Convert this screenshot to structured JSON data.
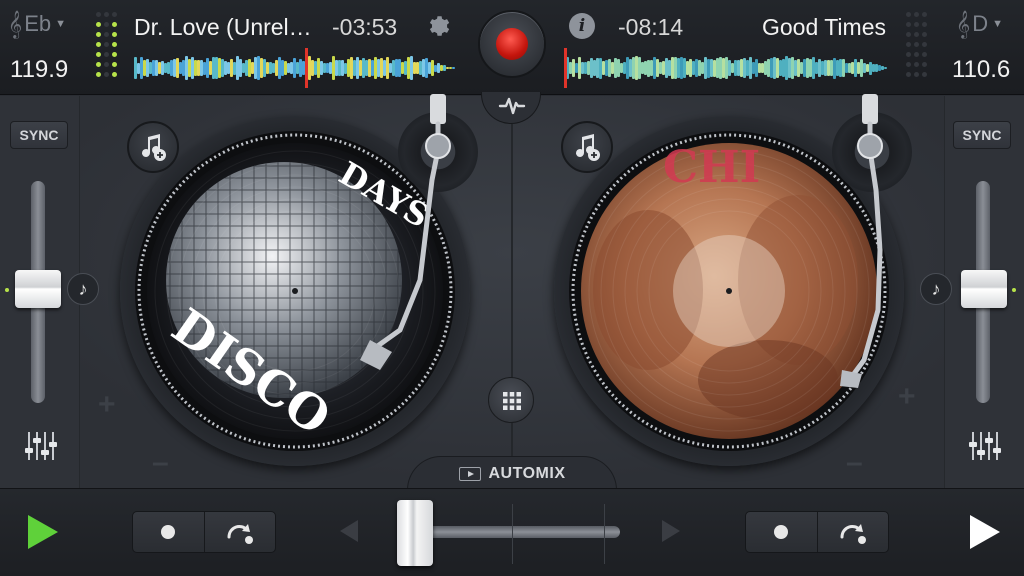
{
  "left_deck": {
    "key": "Eb",
    "bpm": "119.9",
    "track_title": "Dr. Love (Unrel…",
    "time_remaining": "-03:53",
    "sync_label": "SYNC",
    "record_art_text": [
      "DAYS",
      "DISCO"
    ],
    "play_color": "#5fd13a"
  },
  "right_deck": {
    "key": "D",
    "bpm": "110.6",
    "track_title": "Good Times",
    "time_remaining": "-08:14",
    "sync_label": "SYNC",
    "record_art_text": [
      "CHI"
    ],
    "play_color": "#ffffff"
  },
  "center": {
    "automix_label": "AUTOMIX",
    "record_color": "#e0241a"
  },
  "icons": {
    "key": "treble-clef-icon",
    "settings": "gear-icon",
    "info": "info-icon",
    "record": "record-icon",
    "waveform_toggle": "waveform-icon",
    "add_track": "music-note-plus-icon",
    "grid": "grid-icon",
    "eq": "equalizer-sliders-icon",
    "cue": "record-dot-icon",
    "loop": "loop-arrow-icon",
    "play": "play-icon"
  }
}
